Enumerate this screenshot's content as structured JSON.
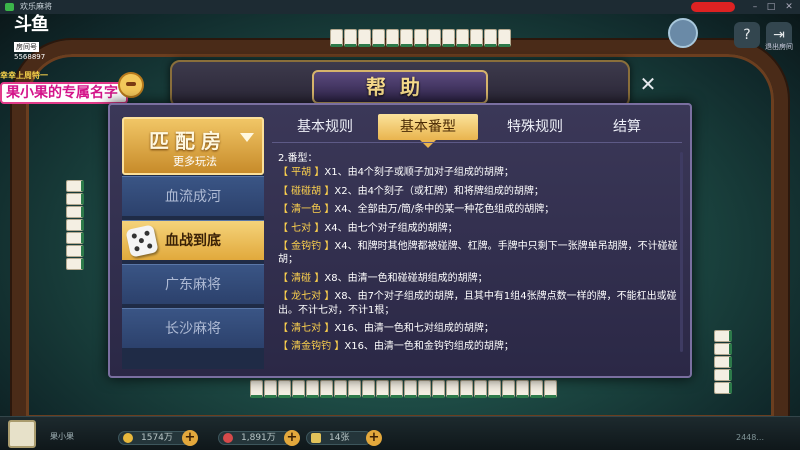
{
  "window": {
    "title": "欢乐麻将",
    "alert_label": ""
  },
  "stream": {
    "logo_text": "斗鱼",
    "room_label": "房间号",
    "room_id": "5568897"
  },
  "streamer": {
    "banner": "果小果的专属名字",
    "deco_text": "幸幸上周特一"
  },
  "top_right": {
    "avatar_label": "",
    "help_label": "",
    "exit_label": "退出房间"
  },
  "dialog": {
    "title": "帮助",
    "close_symbol": "✕",
    "match_title": "匹配房",
    "match_subtitle": "更多玩法",
    "menu": [
      {
        "label": "血流成河"
      },
      {
        "label": "血战到底"
      },
      {
        "label": "广东麻将"
      },
      {
        "label": "长沙麻将"
      }
    ],
    "active_menu_index": 1,
    "tabs": [
      {
        "label": "基本规则"
      },
      {
        "label": "基本番型"
      },
      {
        "label": "特殊规则"
      },
      {
        "label": "结算"
      }
    ],
    "active_tab_index": 1,
    "content_heading": "2.番型：",
    "rules": [
      {
        "tag": "【 平胡 】",
        "text": "X1、由4个刻子或顺子加对子组成的胡牌；"
      },
      {
        "tag": "【 碰碰胡 】",
        "text": "X2、由4个刻子（或杠牌）和将牌组成的胡牌；"
      },
      {
        "tag": "【 清一色 】",
        "text": "X4、全部由万/筒/条中的某一种花色组成的胡牌；"
      },
      {
        "tag": "【 七对 】",
        "text": "X4、由七个对子组成的胡牌；"
      },
      {
        "tag": "【 金钩钓 】",
        "text": "X4、和牌时其他牌都被碰牌、杠牌。手牌中只剩下一张牌单吊胡牌，不计碰碰胡；"
      },
      {
        "tag": "【 清碰 】",
        "text": "X8、由清一色和碰碰胡组成的胡牌；"
      },
      {
        "tag": "【 龙七对 】",
        "text": "X8、由7个对子组成的胡牌，且其中有1组4张牌点数一样的牌，不能杠出或碰出。不计七对，不计1根；"
      },
      {
        "tag": "【 清七对 】",
        "text": "X16、由清一色和七对组成的胡牌；"
      },
      {
        "tag": "【 清金钩钓 】",
        "text": "X16、由清一色和金钩钓组成的胡牌；"
      }
    ]
  },
  "bottom": {
    "player_name": "果小果",
    "gold": "1574万",
    "diamonds": "1,891万",
    "cards": "14张",
    "misc1": "",
    "misc2": "",
    "misc3": "",
    "player_id": "2448..."
  },
  "colors": {
    "accent_gold": "#f5d98a",
    "rule_tag": "#ffd34d",
    "active_menu": "#e1a93c"
  }
}
